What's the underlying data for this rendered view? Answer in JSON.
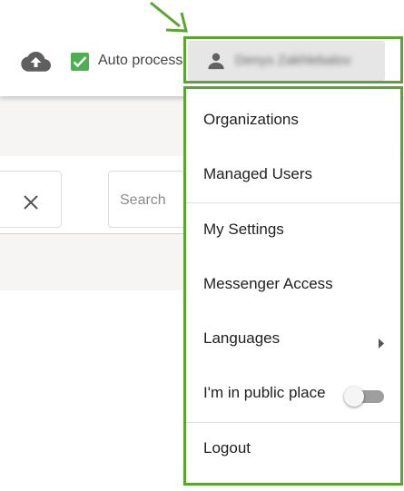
{
  "toolbar": {
    "upload_icon": "cloud-upload-icon",
    "auto_process_label": "Auto process",
    "auto_process_checked": true,
    "user_name": "Denys Zakhlebalov",
    "user_icon": "person-icon"
  },
  "page": {
    "search_placeholder": "Search",
    "clear_icon": "close-icon"
  },
  "menu": {
    "items": [
      {
        "label": "Organizations"
      },
      {
        "label": "Managed Users"
      },
      {
        "label": "My Settings"
      },
      {
        "label": "Messenger Access"
      },
      {
        "label": "Languages",
        "has_submenu": true
      },
      {
        "label": "I'm in public place",
        "toggle_on": false
      },
      {
        "label": "Logout"
      }
    ]
  },
  "colors": {
    "highlight": "#5aa531",
    "checkbox": "#4caf50"
  }
}
